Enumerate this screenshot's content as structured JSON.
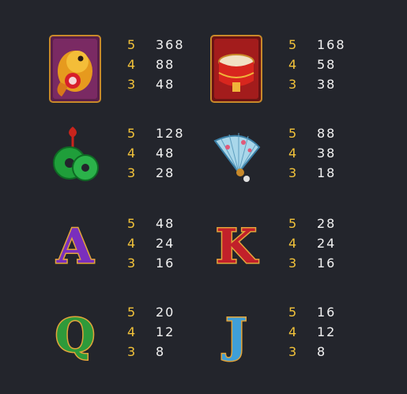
{
  "colors": {
    "background": "#23252c",
    "count_text": "#f3c33a",
    "amount_text": "#f2f2f2"
  },
  "symbols": [
    {
      "icon": "golden-koi-fish-icon",
      "payouts": [
        {
          "count": "5",
          "amount": "368"
        },
        {
          "count": "4",
          "amount": "88"
        },
        {
          "count": "3",
          "amount": "48"
        }
      ]
    },
    {
      "icon": "red-drum-icon",
      "payouts": [
        {
          "count": "5",
          "amount": "168"
        },
        {
          "count": "4",
          "amount": "58"
        },
        {
          "count": "3",
          "amount": "38"
        }
      ]
    },
    {
      "icon": "jade-coins-icon",
      "payouts": [
        {
          "count": "5",
          "amount": "128"
        },
        {
          "count": "4",
          "amount": "48"
        },
        {
          "count": "3",
          "amount": "28"
        }
      ]
    },
    {
      "icon": "folding-fan-icon",
      "payouts": [
        {
          "count": "5",
          "amount": "88"
        },
        {
          "count": "4",
          "amount": "38"
        },
        {
          "count": "3",
          "amount": "18"
        }
      ]
    },
    {
      "icon": "letter-a-icon",
      "letter": "A",
      "payouts": [
        {
          "count": "5",
          "amount": "48"
        },
        {
          "count": "4",
          "amount": "24"
        },
        {
          "count": "3",
          "amount": "16"
        }
      ]
    },
    {
      "icon": "letter-k-icon",
      "letter": "K",
      "payouts": [
        {
          "count": "5",
          "amount": "28"
        },
        {
          "count": "4",
          "amount": "24"
        },
        {
          "count": "3",
          "amount": "16"
        }
      ]
    },
    {
      "icon": "letter-q-icon",
      "letter": "Q",
      "payouts": [
        {
          "count": "5",
          "amount": "20"
        },
        {
          "count": "4",
          "amount": "12"
        },
        {
          "count": "3",
          "amount": "8"
        }
      ]
    },
    {
      "icon": "letter-j-icon",
      "letter": "J",
      "payouts": [
        {
          "count": "5",
          "amount": "16"
        },
        {
          "count": "4",
          "amount": "12"
        },
        {
          "count": "3",
          "amount": "8"
        }
      ]
    }
  ]
}
